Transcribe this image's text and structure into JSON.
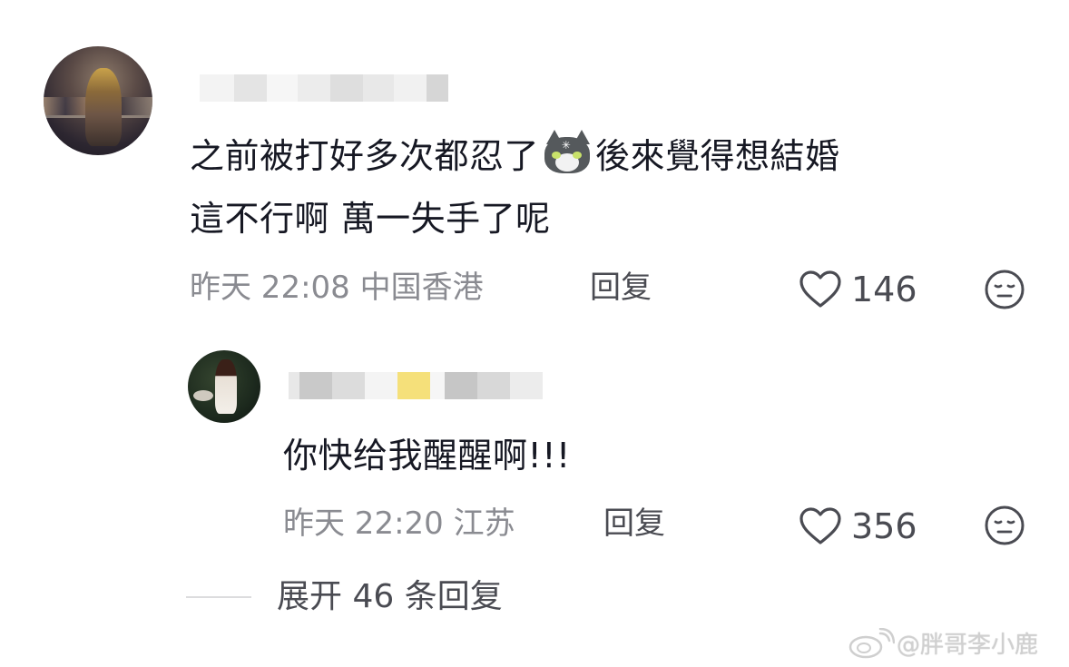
{
  "comment": {
    "line1_before_emoji": "之前被打好多次都忍了",
    "emoji": "cat-face-emoji",
    "line1_after_emoji": "後來覺得想結婚",
    "line2": "這不行啊 萬一失手了呢",
    "time": "昨天 22:08",
    "location": "中国香港",
    "reply_label": "回复",
    "likes": "146"
  },
  "reply": {
    "text": "你快给我醒醒啊!!!",
    "time": "昨天 22:20",
    "location": "江苏",
    "reply_label": "回复",
    "likes": "356"
  },
  "expand": {
    "label": "展开 46 条回复"
  },
  "watermark": {
    "text": "@胖哥李小鹿"
  },
  "colors": {
    "text": "#161823",
    "meta": "#8a8b91",
    "action": "#4a4b52",
    "watermark": "#d0d0d0",
    "blur_highlight": "#f5e07a"
  },
  "icons": [
    "heart-icon",
    "dislike-face-icon",
    "weibo-logo-icon"
  ]
}
